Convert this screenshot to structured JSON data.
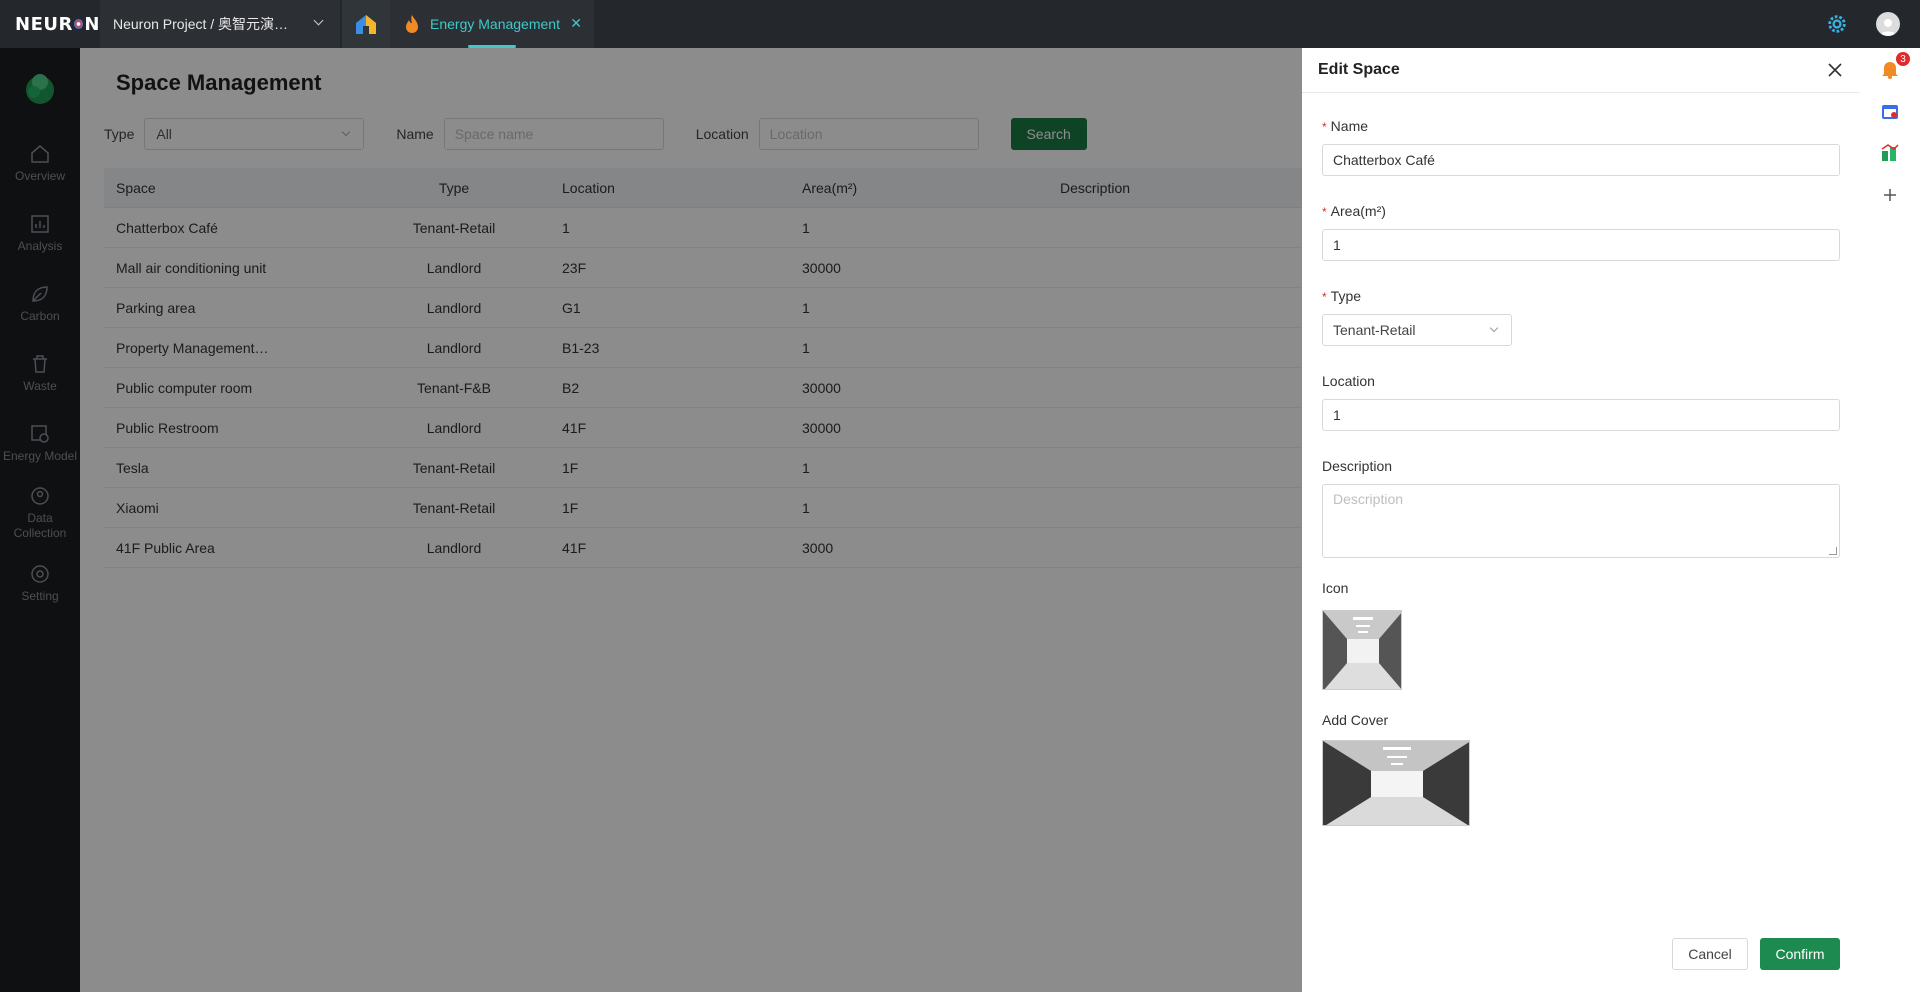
{
  "topbar": {
    "logo_text": "NEUR",
    "logo_text_end": "N",
    "project": "Neuron Project / 奥智元演…",
    "active_tab": "Energy Management"
  },
  "sidebar": {
    "items": [
      {
        "label": "Overview",
        "icon": "home-icon"
      },
      {
        "label": "Analysis",
        "icon": "chart-icon"
      },
      {
        "label": "Carbon",
        "icon": "leaf-icon"
      },
      {
        "label": "Waste",
        "icon": "trash-icon"
      },
      {
        "label": "Energy Model",
        "icon": "model-icon"
      },
      {
        "label": "Data Collection",
        "icon": "data-icon"
      },
      {
        "label": "Setting",
        "icon": "settings-icon"
      }
    ]
  },
  "page": {
    "title": "Space Management",
    "filters": {
      "type_label": "Type",
      "type_value": "All",
      "name_label": "Name",
      "name_placeholder": "Space name",
      "location_label": "Location",
      "location_placeholder": "Location",
      "search_label": "Search"
    },
    "table": {
      "columns": [
        "Space",
        "Type",
        "Location",
        "Area(m²)",
        "Description"
      ],
      "rows": [
        [
          "Chatterbox Café",
          "Tenant-Retail",
          "1",
          "1",
          ""
        ],
        [
          "Mall air conditioning unit",
          "Landlord",
          "23F",
          "30000",
          ""
        ],
        [
          "Parking area",
          "Landlord",
          "G1",
          "1",
          ""
        ],
        [
          "Property Management…",
          "Landlord",
          "B1-23",
          "1",
          ""
        ],
        [
          "Public computer room",
          "Tenant-F&B",
          "B2",
          "30000",
          ""
        ],
        [
          "Public Restroom",
          "Landlord",
          "41F",
          "30000",
          ""
        ],
        [
          "Tesla",
          "Tenant-Retail",
          "1F",
          "1",
          ""
        ],
        [
          "Xiaomi",
          "Tenant-Retail",
          "1F",
          "1",
          ""
        ],
        [
          "41F Public Area",
          "Landlord",
          "41F",
          "3000",
          ""
        ]
      ]
    }
  },
  "right_tools": {
    "notification_count": "3"
  },
  "drawer": {
    "title": "Edit Space",
    "name_label": "Name",
    "name_value": "Chatterbox Café",
    "area_label": "Area(m²)",
    "area_value": "1",
    "type_label": "Type",
    "type_value": "Tenant-Retail",
    "location_label": "Location",
    "location_value": "1",
    "description_label": "Description",
    "description_placeholder": "Description",
    "icon_label": "Icon",
    "cover_label": "Add Cover",
    "cancel_label": "Cancel",
    "confirm_label": "Confirm"
  },
  "colors": {
    "accent": "#1d7a46",
    "tab_active": "#3fc9c9",
    "required": "#e02b2b",
    "topbar_bg": "#24282c",
    "sidebar_bg": "#1a1e22"
  }
}
